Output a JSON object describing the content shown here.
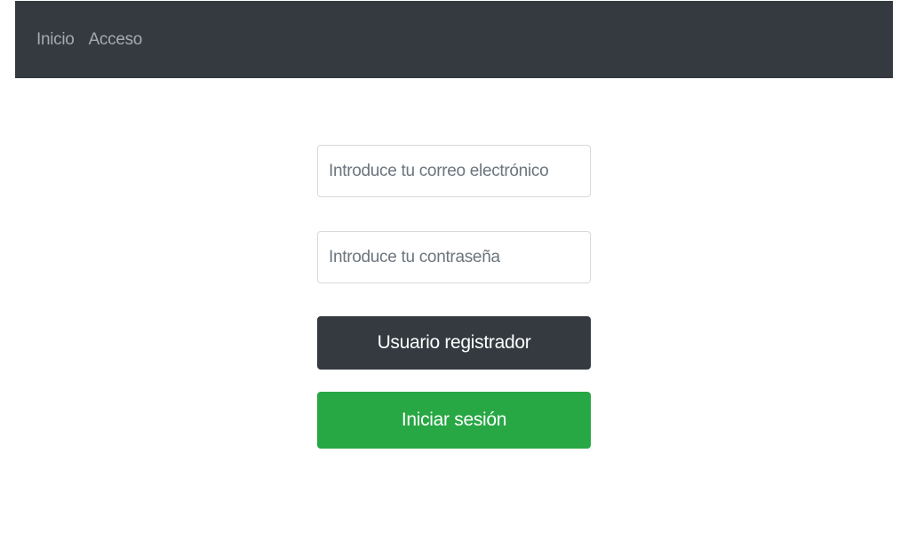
{
  "navbar": {
    "links": [
      {
        "label": "Inicio"
      },
      {
        "label": "Acceso"
      }
    ]
  },
  "login_form": {
    "email_placeholder": "Introduce tu correo electrónico",
    "email_value": "",
    "password_placeholder": "Introduce tu contraseña",
    "password_value": "",
    "register_button_label": "Usuario registrador",
    "login_button_label": "Iniciar sesión"
  },
  "colors": {
    "navbar_bg": "#343a40",
    "register_button_bg": "#343a40",
    "login_button_bg": "#28a745"
  }
}
